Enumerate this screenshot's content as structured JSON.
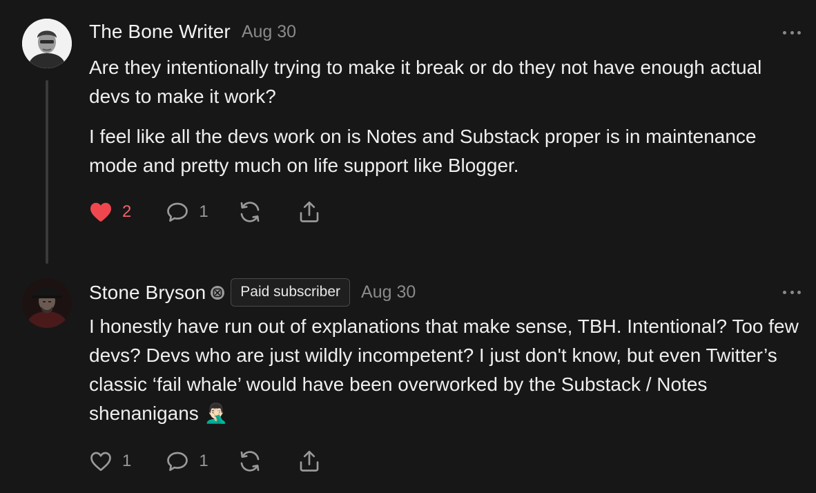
{
  "comments": [
    {
      "author": "The Bone Writer",
      "date": "Aug 30",
      "paragraphs": [
        "Are they intentionally trying to make it break or do they not have enough actual devs to make it work?",
        "I feel like all the devs work on is Notes and Substack proper is in maintenance mode and pretty much on life support like Blogger."
      ],
      "liked": true,
      "like_count": "2",
      "reply_count": "1",
      "icons": {
        "like": "heart-filled-icon",
        "reply": "speech-bubble-icon",
        "restack": "restack-icon",
        "share": "share-icon",
        "more": "more-icon"
      },
      "colors": {
        "like": "#f0474f"
      }
    },
    {
      "author": "Stone Bryson",
      "badge": "Paid subscriber",
      "date": "Aug 30",
      "paragraphs": [
        "I honestly have run out of explanations that make sense, TBH. Intentional? Too few devs? Devs who are just wildly incompetent? I just don't know, but even Twitter’s classic ‘fail whale’ would have been overworked by the Substack / Notes shenanigans 🤦🏻‍♂️"
      ],
      "liked": false,
      "like_count": "1",
      "reply_count": "1",
      "icons": {
        "like": "heart-outline-icon",
        "reply": "speech-bubble-icon",
        "restack": "restack-icon",
        "share": "share-icon",
        "more": "more-icon"
      }
    }
  ]
}
